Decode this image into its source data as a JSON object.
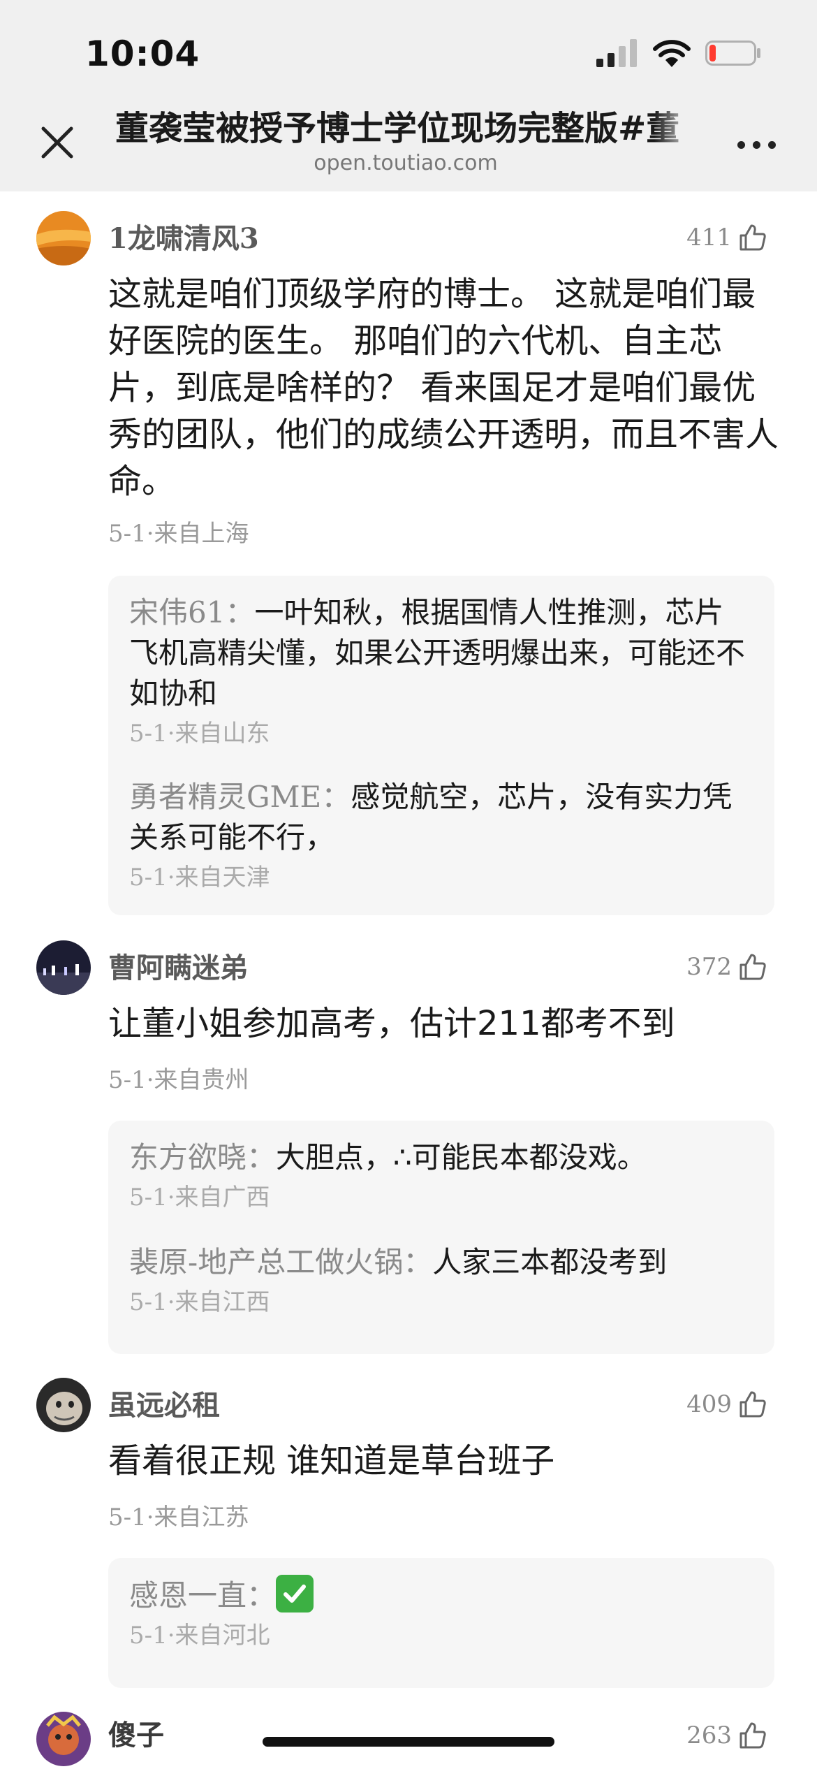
{
  "status_bar": {
    "time": "10:04"
  },
  "header": {
    "title": "董袭莹被授予博士学位现场完整版#董",
    "domain": "open.toutiao.com"
  },
  "comments": [
    {
      "username": "1龙啸清风3",
      "likes": "411",
      "content": "这就是咱们顶级学府的博士。 这就是咱们最好医院的医生。 那咱们的六代机、自主芯片，到底是啥样的？ 看来国足才是咱们最优秀的团队，他们的成绩公开透明，而且不害人命。",
      "meta": "5-1·来自上海",
      "replies": [
        {
          "name": "宋伟61：",
          "text": "一叶知秋，根据国情人性推测，芯片 飞机高精尖懂，如果公开透明爆出来，可能还不如协和",
          "meta": "5-1·来自山东"
        },
        {
          "name": "勇者精灵GME：",
          "text": "感觉航空，芯片，没有实力凭关系可能不行，",
          "meta": "5-1·来自天津"
        }
      ]
    },
    {
      "username": "曹阿瞒迷弟",
      "likes": "372",
      "content": "让董小姐参加高考，估计211都考不到",
      "meta": "5-1·来自贵州",
      "replies": [
        {
          "name": "东方欲晓：",
          "text": "大胆点，∴可能民本都没戏。",
          "meta": "5-1·来自广西"
        },
        {
          "name": "裴原-地产总工做火锅：",
          "text": "人家三本都没考到",
          "meta": "5-1·来自江西"
        }
      ]
    },
    {
      "username": "虽远必租",
      "likes": "409",
      "content": "看着很正规 谁知道是草台班子",
      "meta": "5-1·来自江苏",
      "replies": [
        {
          "name": "感恩一直：",
          "text": "",
          "meta": "5-1·来自河北"
        }
      ]
    },
    {
      "username": "傻子",
      "likes": "263"
    }
  ],
  "icons": {
    "close": "close-icon",
    "more": "more-dots-icon",
    "like": "thumbs-up-icon",
    "reply_emoji": "check-mark-button-emoji"
  },
  "colors": {
    "header_bg": "#f0f0f0",
    "reply_bg": "#f6f6f6",
    "meta_text": "#999999",
    "battery_low": "#ff3b30",
    "emoji_green": "#3cb043"
  },
  "battery_level": 0.12
}
